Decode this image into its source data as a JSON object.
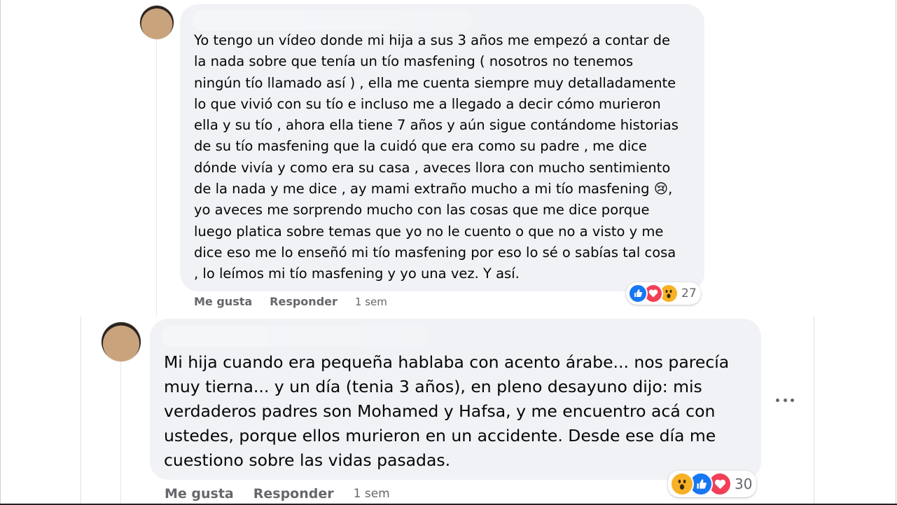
{
  "comments": [
    {
      "text": "Yo tengo un vídeo donde mi hija a sus 3 años me empezó a contar de\nla nada sobre que tenía un tío masfening ( nosotros no tenemos\nningún tío llamado así ) , ella me cuenta siempre muy detalladamente\nlo que vivió con su tío e incluso me a llegado a decir cómo murieron\nella y su tío , ahora ella tiene 7 años y aún sigue contándome historias\nde su tío masfening que la cuidó que era como su padre , me dice\ndónde vivía y como era su casa , aveces llora con mucho sentimiento\nde la nada y me dice , ay mami extraño mucho a mi tío masfening",
      "text_emoji": "😢",
      "text_after": ",\nyo aveces me sorprendo mucho con las cosas que me dice porque\nluego platica sobre temas que yo no le cuento o que no a visto y me\ndice eso me lo enseñó mi tío masfening por eso lo sé o sabías tal cosa\n, lo leímos mi tío masfening y yo una vez. Y así.",
      "like_label": "Me gusta",
      "reply_label": "Responder",
      "time": "1 sem",
      "reaction_icons": [
        "like-icon",
        "love-icon",
        "wow-icon"
      ],
      "reaction_count": "27"
    },
    {
      "text": "Mi hija cuando era pequeña hablaba con acento árabe... nos parecía\nmuy tierna... y un día (tenia 3 años), en pleno desayuno dijo: mis\nverdaderos padres son Mohamed y Hafsa, y me encuentro acá con\nustedes, porque ellos murieron en un accidente. Desde ese día me\ncuestiono sobre las vidas pasadas.",
      "like_label": "Me gusta",
      "reply_label": "Responder",
      "time": "1 sem",
      "reaction_icons": [
        "wow-icon",
        "like-icon",
        "love-icon"
      ],
      "reaction_count": "30"
    }
  ],
  "colors": {
    "bubble": "#f0f2f5",
    "meta_text": "#65676b",
    "like_blue": "#1877f2",
    "love_red": "#f33e58",
    "wow_yellow": "#f7b125"
  }
}
